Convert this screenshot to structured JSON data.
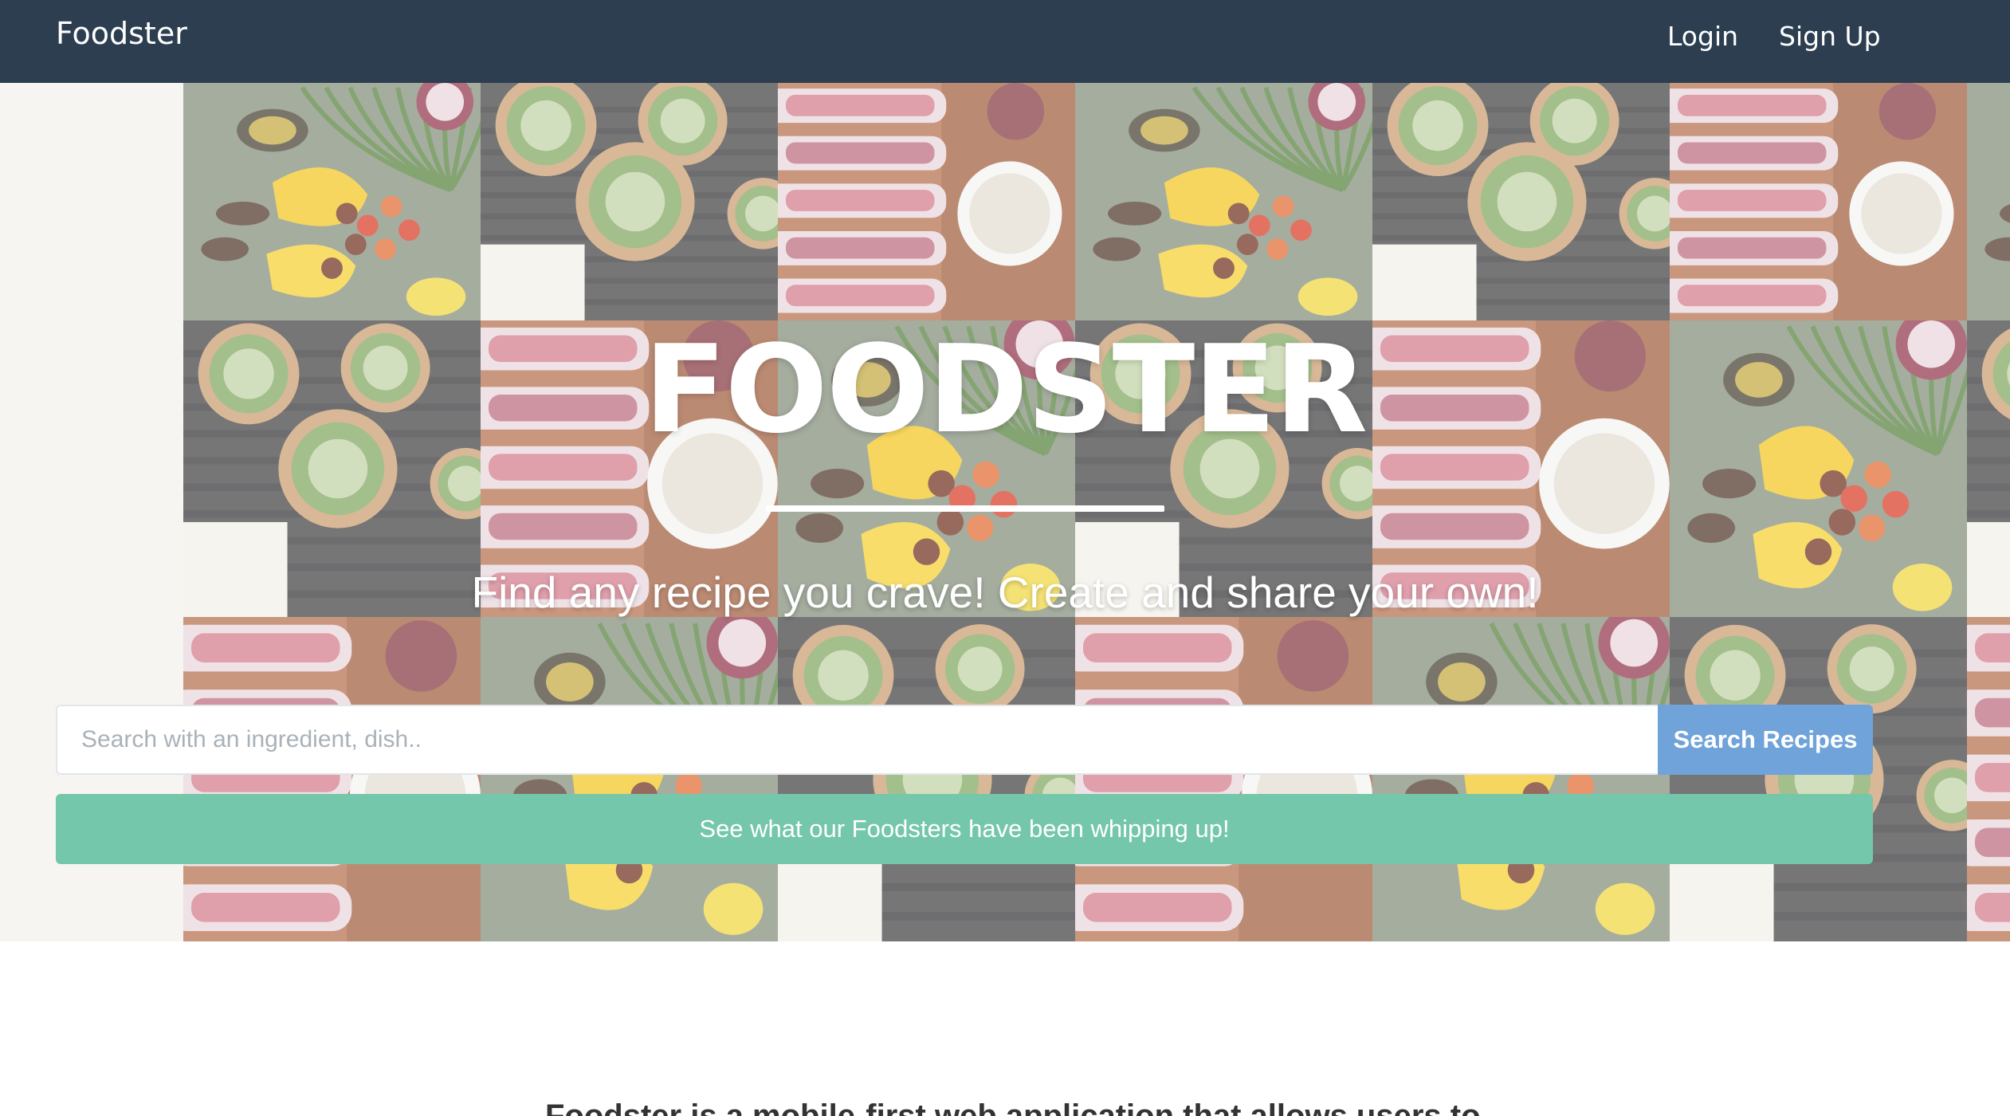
{
  "navbar": {
    "brand": "Foodster",
    "links": [
      {
        "label": "Login"
      },
      {
        "label": "Sign Up"
      }
    ]
  },
  "hero": {
    "title": "FOODSTER",
    "tagline": "Find any recipe you crave! Create and share your own!",
    "search": {
      "placeholder": "Search with an ingredient, dish..",
      "value": "",
      "button_label": "Search Recipes"
    },
    "cta_label": "See what our Foodsters have been whipping up!",
    "background_tiles": [
      "spring-rolls-photo",
      "vegetables-photo",
      "stuffed-mushrooms-photo"
    ]
  },
  "intro": {
    "text": "Foodster is a mobile-first web application that allows users to"
  },
  "colors": {
    "navbar": "#2c3e50",
    "search_button": "#6fa3d9",
    "cta_button": "#74c7ab"
  }
}
